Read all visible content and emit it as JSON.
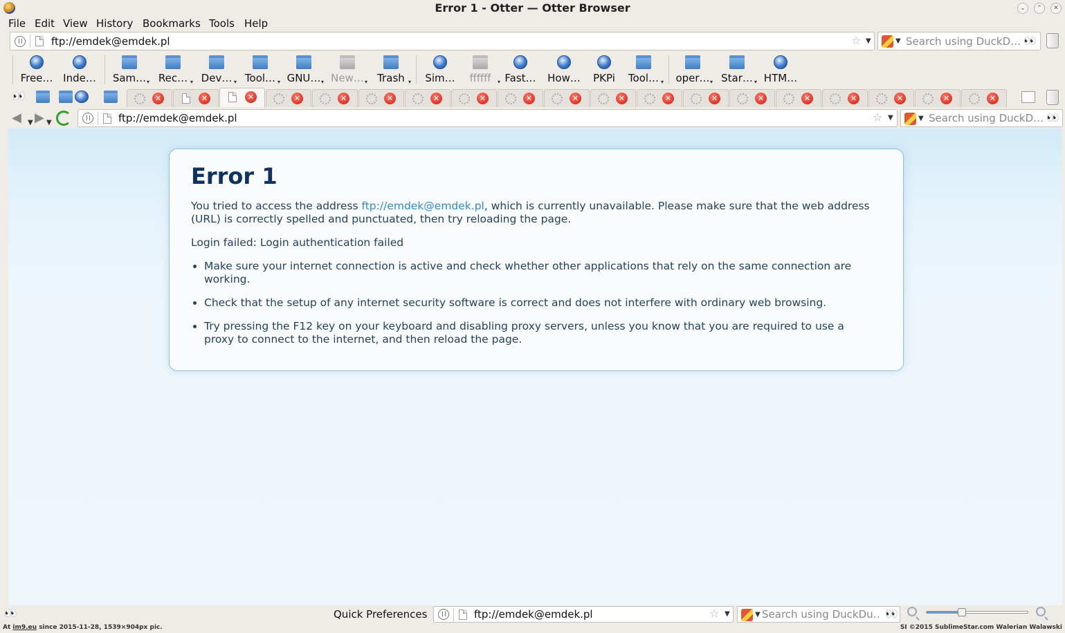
{
  "window": {
    "title": "Error 1 - Otter — Otter Browser",
    "controls": [
      "⌄",
      "⌃",
      "✕"
    ]
  },
  "menu": [
    "File",
    "Edit",
    "View",
    "History",
    "Bookmarks",
    "Tools",
    "Help"
  ],
  "address": {
    "url": "ftp://emdek@emdek.pl"
  },
  "search": {
    "placeholder_top": "Search using DuckD…",
    "placeholder_nav": "Search using DuckD…",
    "placeholder_status": "Search using DuckDu…"
  },
  "bookmarks": [
    {
      "label": "Free…",
      "icon": "globe",
      "submenu": false
    },
    {
      "label": "Inde…",
      "icon": "globe",
      "submenu": false
    },
    {
      "label": "Sam…",
      "icon": "folder",
      "submenu": true
    },
    {
      "label": "Rec…",
      "icon": "folder",
      "submenu": true
    },
    {
      "label": "Dev…",
      "icon": "folder",
      "submenu": true
    },
    {
      "label": "Tool…",
      "icon": "folder",
      "submenu": true
    },
    {
      "label": "GNU…",
      "icon": "folder",
      "submenu": true
    },
    {
      "label": "New…",
      "icon": "folder-grey",
      "submenu": true
    },
    {
      "label": "Trash",
      "icon": "folder",
      "submenu": true
    },
    {
      "label": "Sim…",
      "icon": "globe",
      "submenu": false
    },
    {
      "label": "ffffff",
      "icon": "folder-grey",
      "submenu": true
    },
    {
      "label": "Fast…",
      "icon": "globe",
      "submenu": false
    },
    {
      "label": "How…",
      "icon": "globe",
      "submenu": false
    },
    {
      "label": "PKPi",
      "icon": "globe",
      "submenu": false
    },
    {
      "label": "Tool…",
      "icon": "folder",
      "submenu": true
    },
    {
      "label": "oper…",
      "icon": "folder",
      "submenu": true
    },
    {
      "label": "Star…",
      "icon": "folder",
      "submenu": true
    },
    {
      "label": "HTM…",
      "icon": "globe",
      "submenu": false
    }
  ],
  "tabs": {
    "count": 19,
    "active_index": 2
  },
  "page": {
    "heading": "Error 1",
    "p1_before": "You tried to access the address ",
    "p1_link": "ftp://emdek@emdek.pl",
    "p1_after": ", which is currently unavailable. Please make sure that the web address (URL) is correctly spelled and punctuated, then try reloading the page.",
    "detail": "Login failed: Login authentication failed",
    "tips": [
      "Make sure your internet connection is active and check whether other applications that rely on the same connection are working.",
      "Check that the setup of any internet security software is correct and does not interfere with ordinary web browsing.",
      "Try pressing the F12 key on your keyboard and disabling proxy servers, unless you know that you are required to use a proxy to connect to the internet, and then reload the page."
    ]
  },
  "statusbar": {
    "quick_preferences": "Quick Preferences",
    "zoom_fraction": 0.35
  },
  "watermark": {
    "left_prefix": "At ",
    "left_link": "im9.eu",
    "left_suffix": " since 2015-11-28, 1539×904px pic.",
    "right": "SI ©2015 SublimeStar.com Walerian Walawski"
  }
}
